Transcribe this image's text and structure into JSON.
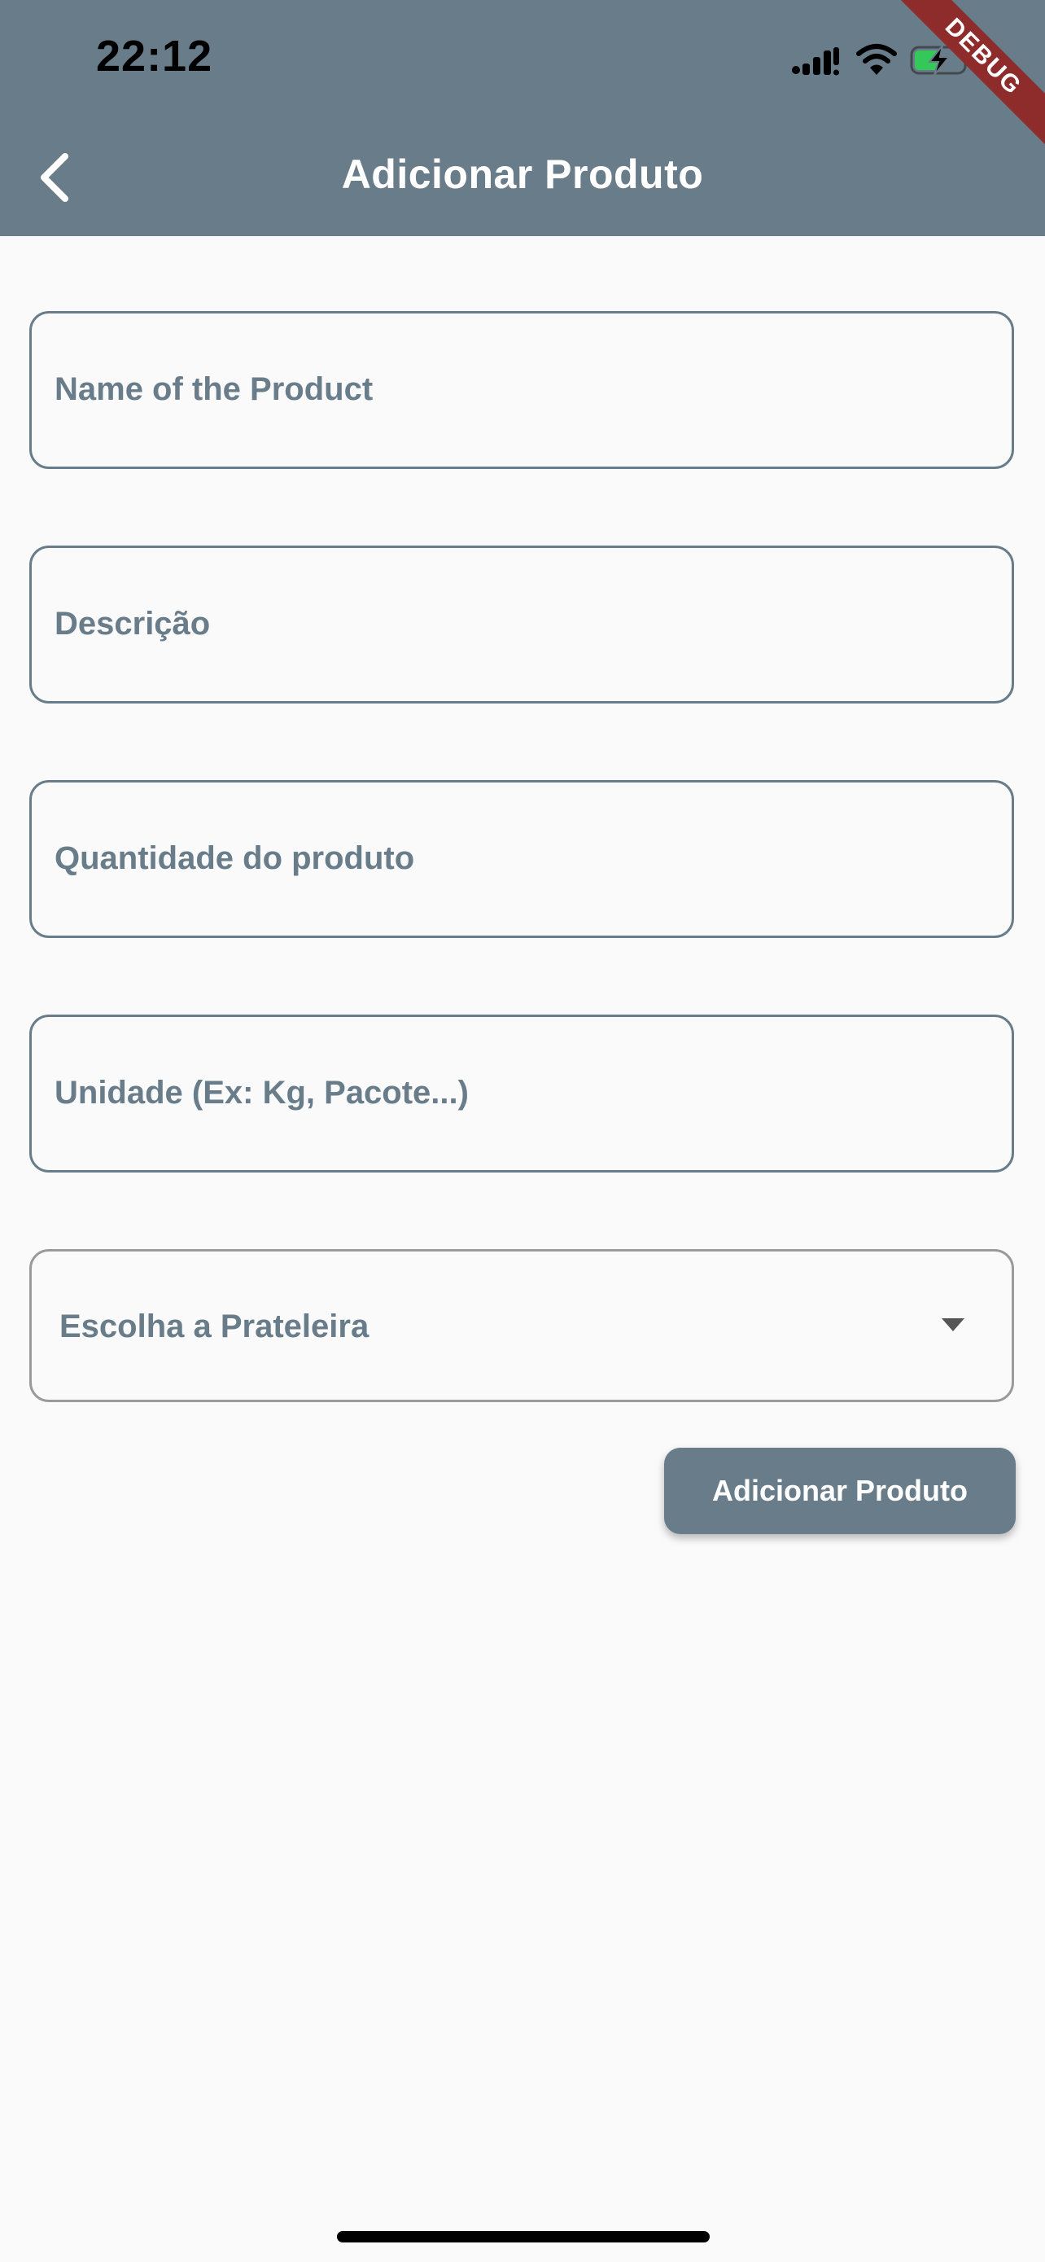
{
  "status_bar": {
    "time": "22:12",
    "icons": [
      "signal-icon",
      "wifi-icon",
      "battery-charging-icon"
    ]
  },
  "debug_banner": "DEBUG",
  "app_bar": {
    "title": "Adicionar Produto",
    "back_icon": "chevron-left-icon",
    "background": "#687c8a"
  },
  "form": {
    "name_placeholder": "Name of the Product",
    "description_placeholder": "Descrição",
    "quantity_placeholder": "Quantidade do produto",
    "unit_placeholder": "Unidade (Ex: Kg, Pacote...)",
    "shelf_dropdown": {
      "hint": "Escolha a Prateleira",
      "icon": "caret-down-icon"
    },
    "submit_label": "Adicionar Produto"
  },
  "colors": {
    "accent": "#687c8a",
    "background": "#fafafa",
    "debug_ribbon": "#8e2b2b"
  }
}
